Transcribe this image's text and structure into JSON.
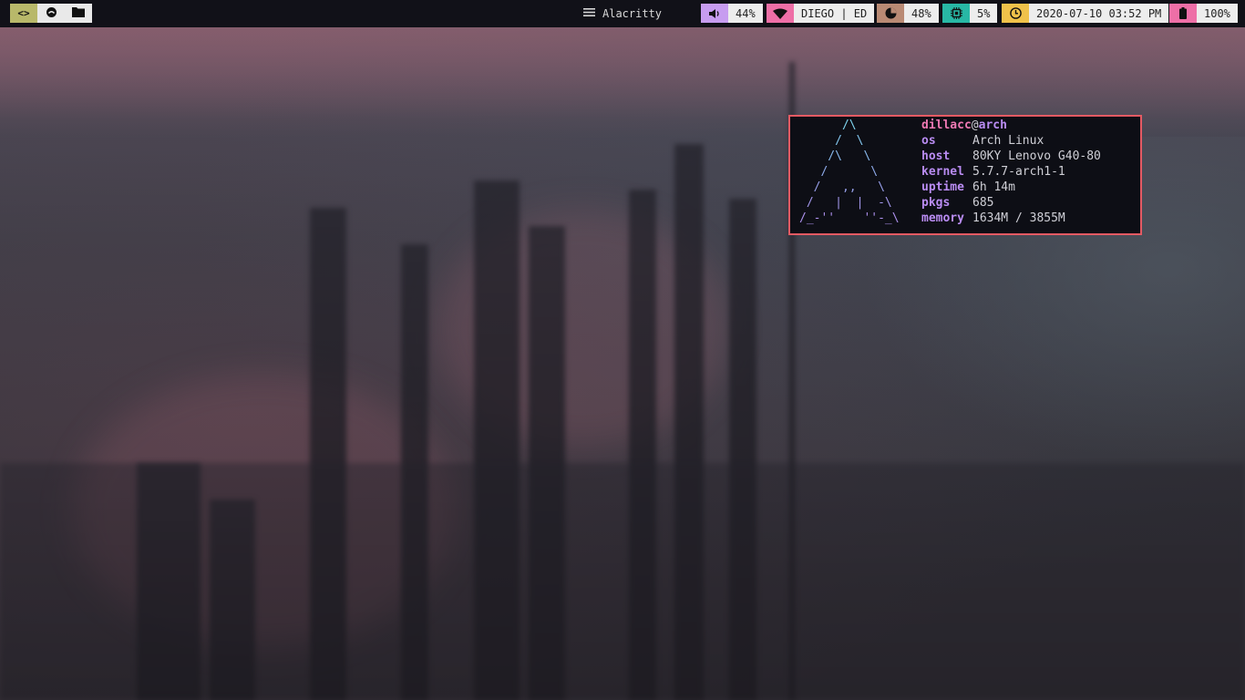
{
  "colors": {
    "bar_bg": "#111118",
    "workspace_active": "#b8b86a",
    "workspace_inactive": "#e9e9e9",
    "volume_accent": "#c79cf0",
    "network_accent": "#ee6fa7",
    "memory_accent": "#b98a74",
    "cpu_accent": "#28b8a5",
    "date_accent": "#f0c24a",
    "battery_accent": "#ee6fa7",
    "terminal_border": "#e45a63",
    "terminal_bg": "#0d0e15"
  },
  "topbar": {
    "workspaces": [
      {
        "icon": "code-icon",
        "glyph": "<>"
      },
      {
        "icon": "circle-icon"
      },
      {
        "icon": "folder-icon"
      }
    ],
    "window_title": {
      "icon": "menu-icon",
      "text": "Alacritty"
    },
    "modules": {
      "volume": {
        "icon": "volume-icon",
        "value": "44%"
      },
      "network": {
        "icon": "wifi-icon",
        "value": "DIEGO | ED"
      },
      "memory": {
        "icon": "pie-chart-icon",
        "value": "48%"
      },
      "cpu": {
        "icon": "cpu-icon",
        "value": "5%"
      },
      "date": {
        "icon": "clock-icon",
        "value": "2020-07-10 03:52 PM"
      },
      "battery": {
        "icon": "battery-icon",
        "value": "100%"
      }
    }
  },
  "terminal": {
    "ascii_art": [
      "      /\\",
      "     /  \\",
      "    /\\   \\",
      "   /      \\",
      "  /   ,,   \\",
      " /   |  |  -\\",
      "/_-''    ''-_\\"
    ],
    "user": "dillacc",
    "at": "@",
    "hostname": "arch",
    "info": [
      {
        "key": "os",
        "value": "Arch Linux"
      },
      {
        "key": "host",
        "value": "80KY Lenovo G40-80"
      },
      {
        "key": "kernel",
        "value": "5.7.7-arch1-1"
      },
      {
        "key": "uptime",
        "value": "6h 14m"
      },
      {
        "key": "pkgs",
        "value": "685"
      },
      {
        "key": "memory",
        "value": "1634M / 3855M"
      }
    ]
  }
}
